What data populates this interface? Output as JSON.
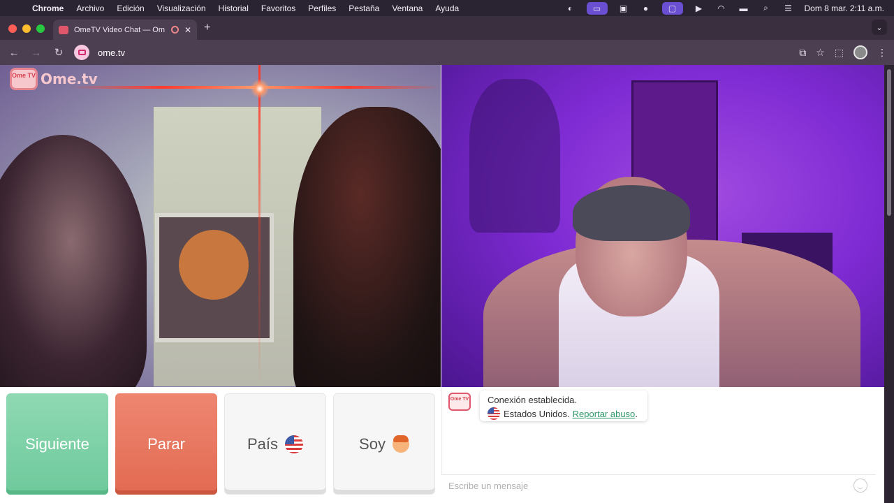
{
  "menubar": {
    "apple_glyph": "",
    "app_name": "Chrome",
    "items": [
      "Archivo",
      "Edición",
      "Visualización",
      "Historial",
      "Favoritos",
      "Perfiles",
      "Pestaña",
      "Ventana",
      "Ayuda"
    ],
    "clock": "Dom 8 mar.  2:11 a.m."
  },
  "browser": {
    "tab_title": "OmeTV Video Chat — Om",
    "tab_close": "✕",
    "new_tab": "+",
    "url": "ome.tv",
    "back_glyph": "←",
    "forward_glyph": "→",
    "reload_glyph": "↻"
  },
  "site": {
    "logo_tv": "Ome TV",
    "logo_word": "Ome.tv"
  },
  "controls": {
    "next": "Siguiente",
    "stop": "Parar",
    "country": "País",
    "gender": "Soy"
  },
  "chat": {
    "bot_label": "Ome TV",
    "connected": "Conexión establecida.",
    "country": "Estados Unidos.",
    "report": "Reportar abuso",
    "report_suffix": ".",
    "input_placeholder": "Escribe un mensaje"
  },
  "colors": {
    "next": "#6ec99b",
    "stop": "#e26a52",
    "link": "#2f9a6a"
  }
}
